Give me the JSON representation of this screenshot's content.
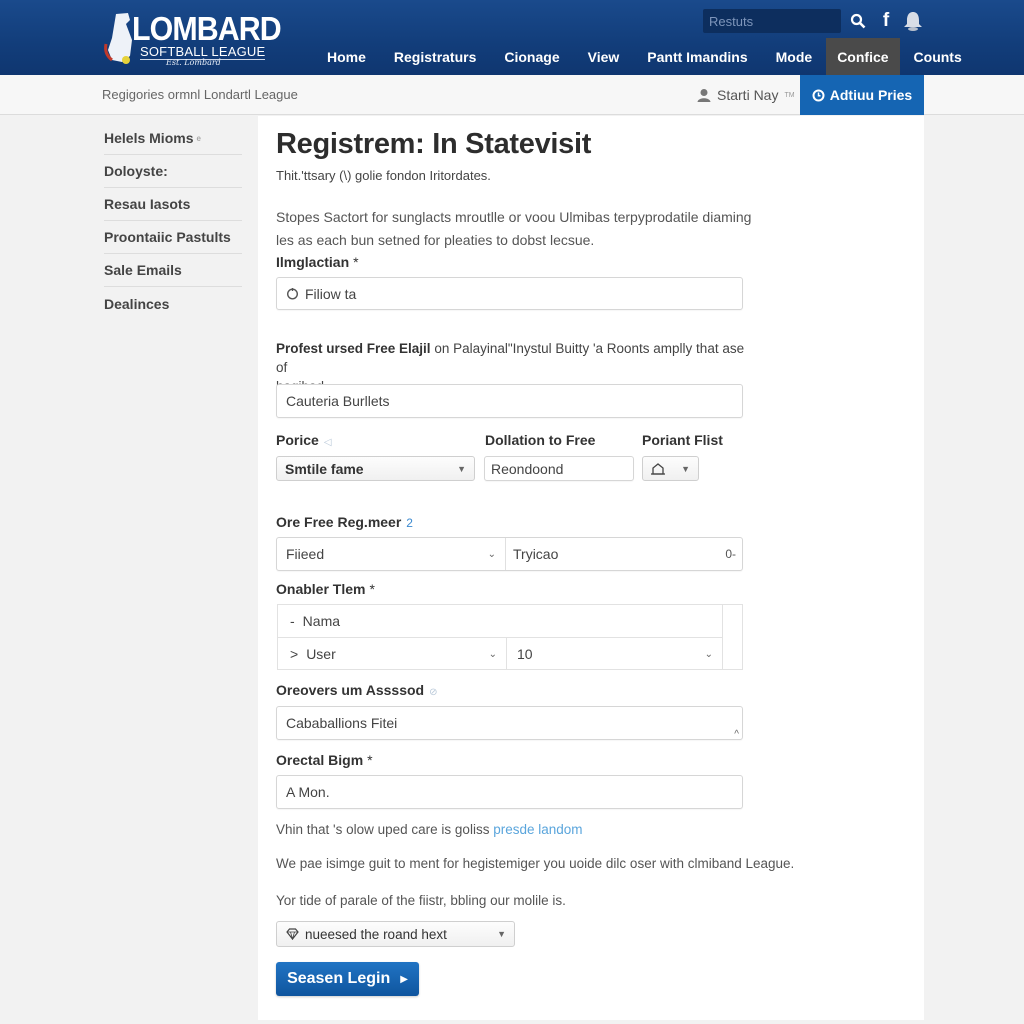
{
  "header": {
    "logo": {
      "title": "LOMBARD",
      "subtitle": "SOFTBALL LEAGUE",
      "script": "Est. Lombard"
    },
    "search_placeholder": "Restuts",
    "icons": [
      "search-icon",
      "facebook-icon",
      "notification-bell-icon"
    ],
    "nav": [
      {
        "label": "Home",
        "active": false
      },
      {
        "label": "Registraturs",
        "active": false
      },
      {
        "label": "Cionage",
        "active": false
      },
      {
        "label": "View",
        "active": false
      },
      {
        "label": "Pantt Imandins",
        "active": false
      },
      {
        "label": "Mode",
        "active": false
      },
      {
        "label": "Confice",
        "active": true
      },
      {
        "label": "Counts",
        "active": false
      }
    ],
    "colors": {
      "header_bg": "#123d7a",
      "active_nav": "#4a4a4a",
      "accent": "#1565b3"
    }
  },
  "subheader": {
    "breadcrumb": "Regigories ormnl Londartl League",
    "user_link": "Starti Nay",
    "user_link_mark": "TM",
    "cta_label": "Adtiuu Pries"
  },
  "sidebar": {
    "items": [
      {
        "label": "Helels Mioms",
        "mark": "e"
      },
      {
        "label": "Doloyste:"
      },
      {
        "label": "Resau Iasots"
      },
      {
        "label": "Proontaiic Pastults"
      },
      {
        "label": "Sale Emails"
      },
      {
        "label": "Dealinces"
      }
    ]
  },
  "main": {
    "title": "Registrem: In Statevisit",
    "subtitle": "Thit.'ttsary (\\) golie fondon Iritordates.",
    "intro_line1": "Stopes Sactort for sunglacts mroutlle or voou Ulmibas terpyprodatile diaming",
    "intro_line2": "les as each bun setned for pleaties to dobst lecsue.",
    "field1": {
      "label": "Ilmglactian",
      "required": "*",
      "value": "Filiow ta"
    },
    "field2": {
      "label_bold": "Profest ursed Free Elajil",
      "label_rest": " on Palayinal\"Inystul Buitty 'a Roonts amplly that ase of",
      "label_line2": "hagibad",
      "value": "Cauteria Burllets"
    },
    "row3": {
      "price": {
        "label": "Porice",
        "value": "Smtile fame"
      },
      "donation": {
        "label": "Dollation to Free",
        "value": "Reondoond"
      },
      "portant": {
        "label": "Poriant Flist",
        "value": ""
      }
    },
    "field4": {
      "label": "Ore Free Reg.meer",
      "hint": "2",
      "select_value": "Fiieed",
      "input_value": "Tryicao",
      "suffix": "0-"
    },
    "field5": {
      "label": "Onabler Tlem",
      "required": "*",
      "row1": {
        "prefix": "-",
        "value": "Nama"
      },
      "row2": {
        "prefix": ">",
        "value": "User",
        "count": "10"
      }
    },
    "field6": {
      "label": "Oreovers um Assssod",
      "value": "Cababallions Fitei"
    },
    "field7": {
      "label": "Orectal Bigm",
      "required": "*",
      "value": "A Mon."
    },
    "note": {
      "text": "Vhin that 's olow uped care is goliss ",
      "link": "presde landom"
    },
    "para2": "We pae isimge guit to ment for hegistemiger you uoide dilc oser with clmiband League.",
    "para3": "Yor tide of parale of the fiistr, bbling our molile is.",
    "final_select": "nueesed the roand hext",
    "submit_label": "Seasen Legin"
  }
}
